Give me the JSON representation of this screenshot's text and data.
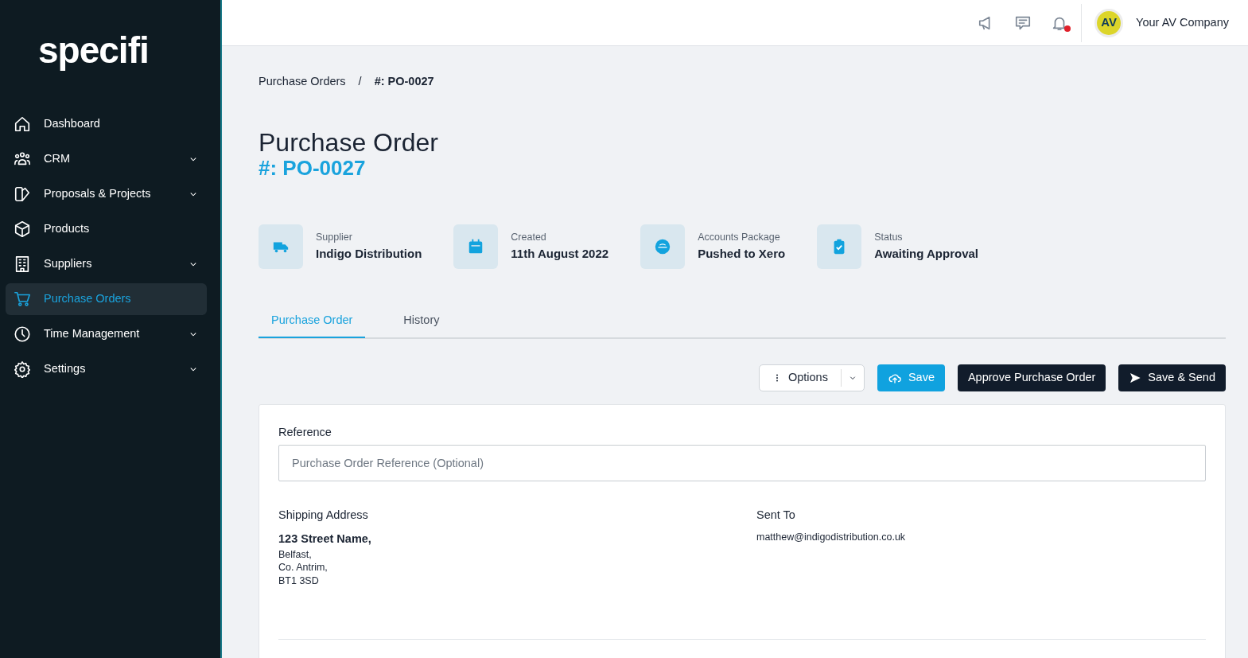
{
  "logo": "specifi",
  "sidebar": {
    "items": [
      {
        "label": "Dashboard",
        "has_submenu": false,
        "selected": false
      },
      {
        "label": "CRM",
        "has_submenu": true,
        "selected": false
      },
      {
        "label": "Proposals & Projects",
        "has_submenu": true,
        "selected": false
      },
      {
        "label": "Products",
        "has_submenu": false,
        "selected": false
      },
      {
        "label": "Suppliers",
        "has_submenu": true,
        "selected": false
      },
      {
        "label": "Purchase Orders",
        "has_submenu": false,
        "selected": true
      },
      {
        "label": "Time Management",
        "has_submenu": true,
        "selected": false
      },
      {
        "label": "Settings",
        "has_submenu": true,
        "selected": false
      }
    ]
  },
  "header": {
    "notifications_unread": true,
    "avatar_initials": "AV",
    "company": "Your AV Company"
  },
  "breadcrumb": {
    "items": [
      "Purchase Orders",
      "#: PO-0027"
    ],
    "separator": "/"
  },
  "page_title": "Purchase Order",
  "page_subtitle": "#: PO-0027",
  "info": [
    {
      "label": "Supplier",
      "value": "Indigo Distribution"
    },
    {
      "label": "Created",
      "value": "11th August 2022"
    },
    {
      "label": "Accounts Package",
      "value": "Pushed to Xero"
    },
    {
      "label": "Status",
      "value": "Awaiting Approval"
    }
  ],
  "tabs": [
    {
      "label": "Purchase Order",
      "selected": true
    },
    {
      "label": "History",
      "selected": false
    }
  ],
  "buttons": [
    {
      "kind": "options",
      "label": "Options"
    },
    {
      "kind": "save",
      "label": "Save"
    },
    {
      "kind": "dark",
      "label": "Approve Purchase Order"
    },
    {
      "kind": "send",
      "label": "Save & Send"
    }
  ],
  "form": {
    "reference": {
      "label": "Reference",
      "placeholder": "Purchase Order Reference (Optional)"
    },
    "shipping": {
      "label": "Shipping Address",
      "lines": [
        "123 Street Name,",
        "Belfast,",
        "Co. Antrim,",
        "BT1 3SD"
      ]
    },
    "sent_to": {
      "label": "Sent To",
      "email": "matthew@indigodistribution.co.uk"
    }
  }
}
